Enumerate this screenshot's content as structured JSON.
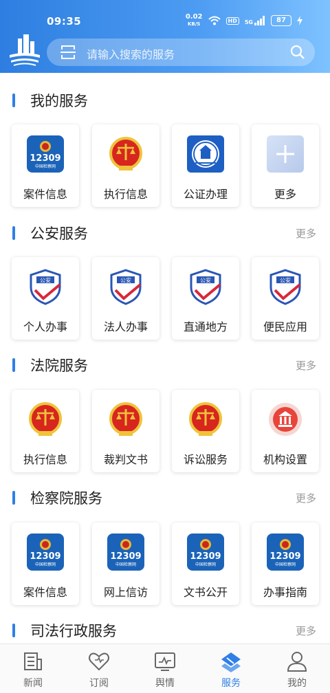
{
  "status": {
    "time": "09:35",
    "net_speed": "0.02",
    "net_unit": "KB/S",
    "hd": "HD",
    "signal": "5G",
    "battery": "87"
  },
  "search": {
    "placeholder": "请输入搜索的服务"
  },
  "sections": [
    {
      "title": "我的服务",
      "more": "",
      "items": [
        {
          "label": "案件信息",
          "icon": "procuratorate-12309-icon"
        },
        {
          "label": "执行信息",
          "icon": "court-emblem-icon"
        },
        {
          "label": "公证办理",
          "icon": "notary-emblem-icon"
        },
        {
          "label": "更多",
          "icon": "plus-icon"
        }
      ]
    },
    {
      "title": "公安服务",
      "more": "更多",
      "items": [
        {
          "label": "个人办事",
          "icon": "police-shield-icon"
        },
        {
          "label": "法人办事",
          "icon": "police-shield-icon"
        },
        {
          "label": "直通地方",
          "icon": "police-shield-icon"
        },
        {
          "label": "便民应用",
          "icon": "police-shield-icon"
        }
      ]
    },
    {
      "title": "法院服务",
      "more": "更多",
      "items": [
        {
          "label": "执行信息",
          "icon": "court-emblem-icon"
        },
        {
          "label": "裁判文书",
          "icon": "court-emblem-icon"
        },
        {
          "label": "诉讼服务",
          "icon": "court-emblem-icon"
        },
        {
          "label": "机构设置",
          "icon": "institution-building-icon"
        }
      ]
    },
    {
      "title": "检察院服务",
      "more": "更多",
      "items": [
        {
          "label": "案件信息",
          "icon": "procuratorate-12309-icon"
        },
        {
          "label": "网上信访",
          "icon": "procuratorate-12309-icon"
        },
        {
          "label": "文书公开",
          "icon": "procuratorate-12309-icon"
        },
        {
          "label": "办事指南",
          "icon": "procuratorate-12309-icon"
        }
      ]
    },
    {
      "title": "司法行政服务",
      "more": "更多",
      "items": []
    }
  ],
  "icon_texts": {
    "hotline": "12309",
    "hotline_sub": "中国检察网",
    "police": "公安"
  },
  "tabs": [
    {
      "label": "新闻",
      "icon": "news-icon"
    },
    {
      "label": "订阅",
      "icon": "heart-icon"
    },
    {
      "label": "舆情",
      "icon": "monitor-icon"
    },
    {
      "label": "服务",
      "icon": "service-icon",
      "active": true
    },
    {
      "label": "我的",
      "icon": "user-icon"
    }
  ],
  "colors": {
    "accent": "#2f7fe6",
    "header_start": "#2d7ee0",
    "header_end": "#7ec2ff"
  }
}
